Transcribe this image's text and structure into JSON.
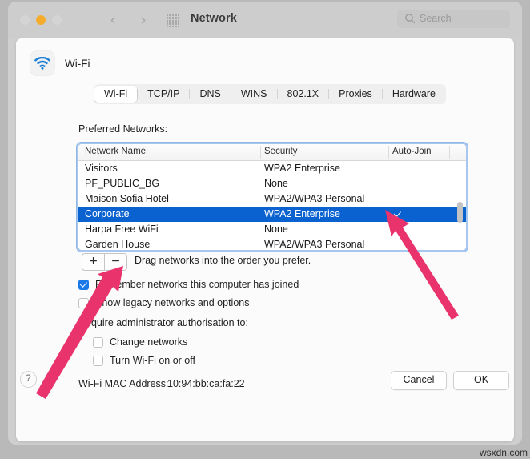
{
  "titlebar": {
    "title": "Network",
    "search_placeholder": "Search",
    "back_glyph": "‹",
    "forward_glyph": "›"
  },
  "panel": {
    "service_name": "Wi-Fi",
    "tabs": [
      {
        "label": "Wi-Fi",
        "selected": true
      },
      {
        "label": "TCP/IP",
        "selected": false
      },
      {
        "label": "DNS",
        "selected": false
      },
      {
        "label": "WINS",
        "selected": false
      },
      {
        "label": "802.1X",
        "selected": false
      },
      {
        "label": "Proxies",
        "selected": false
      },
      {
        "label": "Hardware",
        "selected": false
      }
    ],
    "preferred_networks_label": "Preferred Networks:",
    "table": {
      "columns": [
        "Network Name",
        "Security",
        "Auto-Join"
      ],
      "rows": [
        {
          "name": "Visitors",
          "security": "WPA2 Enterprise",
          "auto_join": true,
          "selected": false
        },
        {
          "name": "PF_PUBLIC_BG",
          "security": "None",
          "auto_join": true,
          "selected": false
        },
        {
          "name": "Maison Sofia Hotel",
          "security": "WPA2/WPA3 Personal",
          "auto_join": true,
          "selected": false
        },
        {
          "name": "Corporate",
          "security": "WPA2 Enterprise",
          "auto_join": true,
          "selected": true
        },
        {
          "name": "Harpa Free WiFi",
          "security": "None",
          "auto_join": true,
          "selected": false
        },
        {
          "name": "Garden House",
          "security": "WPA2/WPA3 Personal",
          "auto_join": true,
          "selected": false
        }
      ]
    },
    "add_button_label": "+",
    "remove_button_label": "−",
    "drag_hint": "Drag networks into the order you prefer.",
    "options": [
      {
        "label": "Remember networks this computer has joined",
        "checked": true
      },
      {
        "label": "Show legacy networks and options",
        "checked": false
      }
    ],
    "admin_label": "Require administrator authorisation to:",
    "admin_options": [
      {
        "label": "Change networks",
        "checked": false
      },
      {
        "label": "Turn Wi-Fi on or off",
        "checked": false
      }
    ],
    "mac_label": "Wi-Fi MAC Address:",
    "mac_value": "10:94:bb:ca:fa:22"
  },
  "footer": {
    "help_label": "?",
    "cancel_label": "Cancel",
    "ok_label": "OK"
  },
  "watermark": "wsxdn.com",
  "colors": {
    "selection_blue": "#0a62d0",
    "checkbox_blue": "#1a79e8",
    "wifi_icon_blue": "#1a7fd6",
    "annotation_pink": "#e8336d",
    "focus_ring": "#a7c7ee"
  }
}
